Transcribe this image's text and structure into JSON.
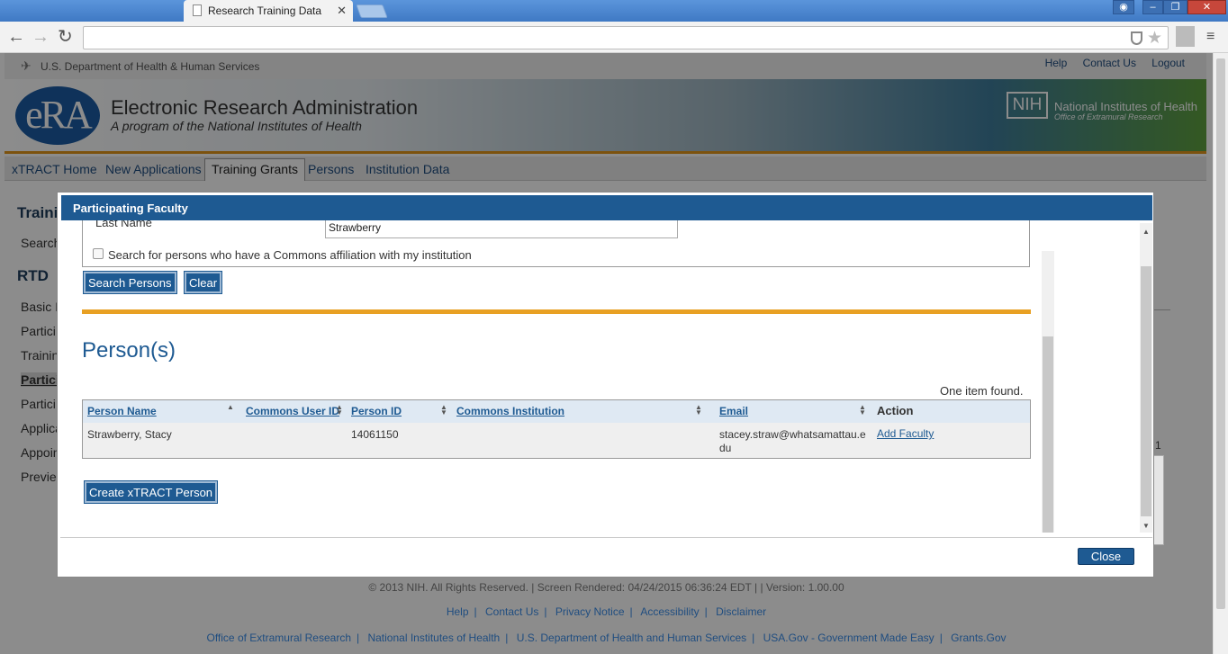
{
  "browser": {
    "tab_title": "Research Training Data",
    "tab_close": "✕",
    "address": ""
  },
  "header": {
    "agency": "U.S. Department of Health & Human Services",
    "links": [
      "Help",
      "Contact Us",
      "Logout"
    ],
    "app_title": "Electronic Research Administration",
    "app_subtitle": "A program of the National Institutes of Health",
    "logo_text": "eRA",
    "nih_box": "NIH",
    "nih_name": "National Institutes of Health",
    "nih_office": "Office of Extramural Research"
  },
  "main_nav": [
    "xTRACT Home",
    "New Applications",
    "Training Grants",
    "Persons",
    "Institution Data"
  ],
  "left_panel": {
    "items": [
      "Traini",
      "Search",
      "RTD",
      "Basic I",
      "Partici",
      "Trainin",
      "Partici",
      "Partici",
      "Applica",
      "Appoin",
      "Previe"
    ]
  },
  "modal": {
    "title": "Participating Faculty",
    "last_name_label": "Last Name",
    "last_name_value": "Strawberry",
    "affiliation_label": "Search for persons who have a Commons affiliation with my institution",
    "search_button": "Search Persons",
    "clear_button": "Clear",
    "results_heading": "Person(s)",
    "found_text": "One item found.",
    "columns": [
      "Person Name",
      "Commons User ID",
      "Person ID",
      "Commons Institution",
      "Email",
      "Action"
    ],
    "rows": [
      {
        "person_name": "Strawberry, Stacy",
        "commons_user_id": "",
        "person_id": "14061150",
        "commons_institution": "",
        "email": "stacey.straw@whatsamattau.edu",
        "action": "Add Faculty"
      }
    ],
    "create_button": "Create xTRACT Person",
    "close_button": "Close"
  },
  "background_fragment": "1",
  "footer": {
    "copyright": "© 2013 NIH. All Rights Reserved. | Screen Rendered: 04/24/2015 06:36:24 EDT | | Version: 1.00.00",
    "links1": [
      "Help",
      "Contact Us",
      "Privacy Notice",
      "Accessibility",
      "Disclaimer"
    ],
    "links2": [
      "Office of Extramural Research",
      "National Institutes of Health",
      "U.S. Department of Health and Human Services",
      "USA.Gov - Government Made Easy",
      "Grants.Gov"
    ]
  },
  "colors": {
    "accent": "#1e5a92",
    "orange": "#e8a023"
  }
}
